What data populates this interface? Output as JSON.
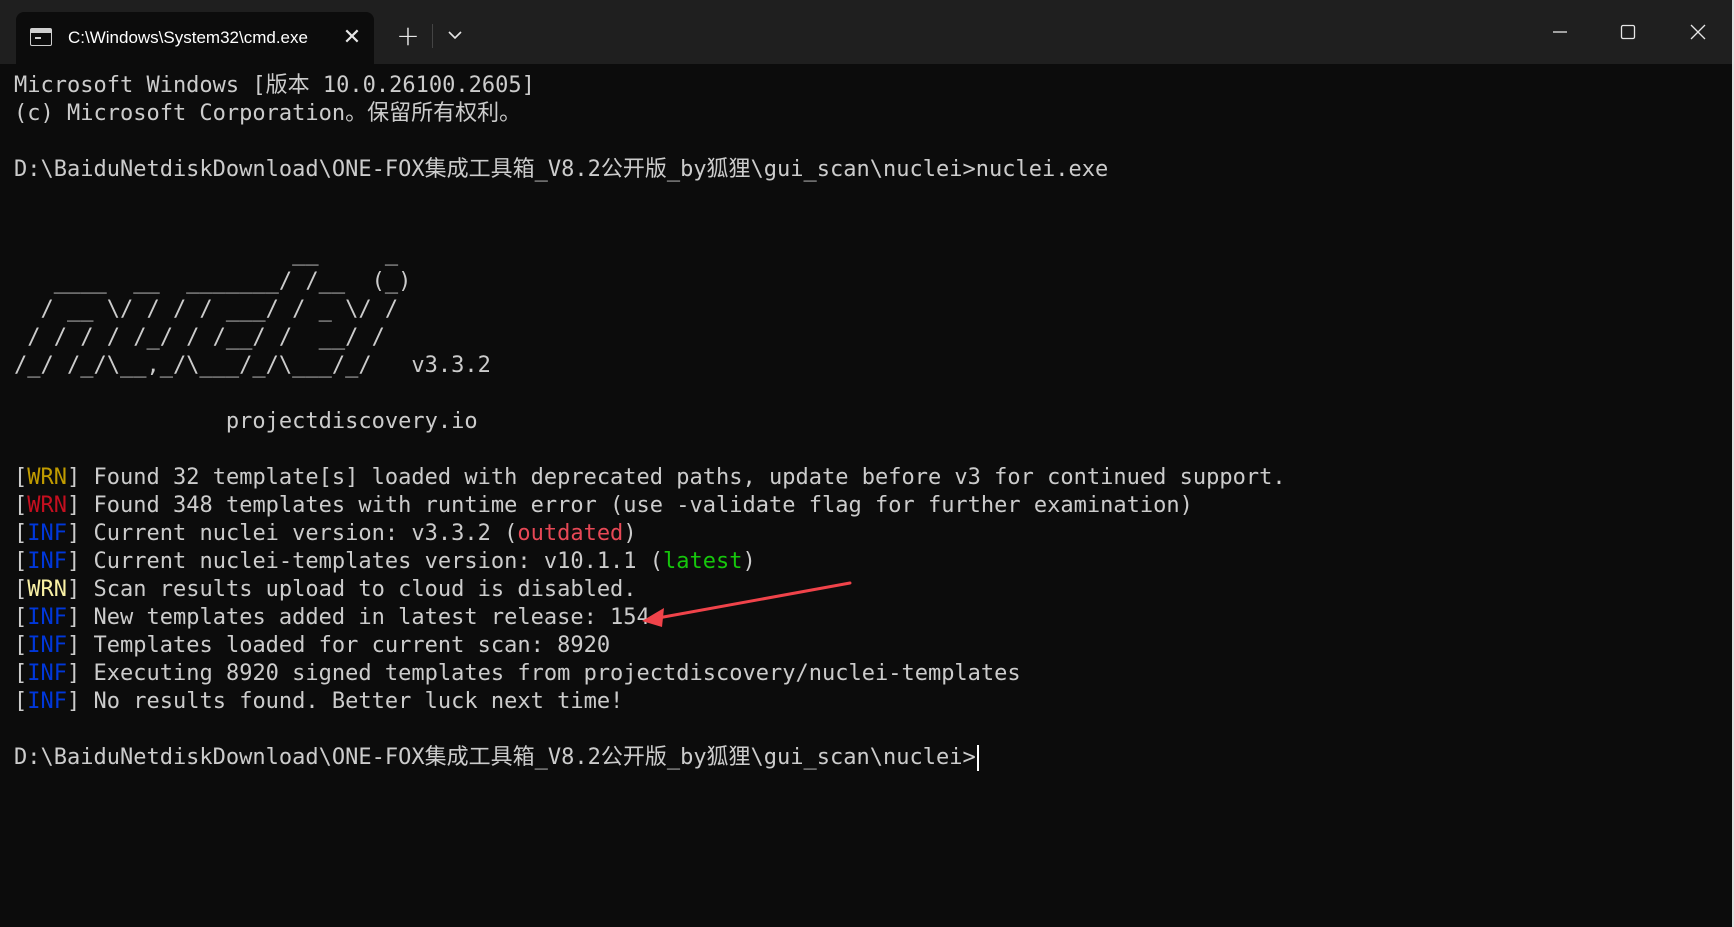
{
  "window": {
    "tab_title": "C:\\Windows\\System32\\cmd.exe",
    "new_tab_glyph": "+",
    "tab_close_glyph": "✕",
    "icons": {
      "tab": "cmd-icon",
      "close_tab": "close-icon",
      "new_tab": "plus-icon",
      "dropdown": "chevron-down-icon",
      "minimize": "minimize-icon",
      "maximize": "maximize-icon",
      "close_window": "close-icon"
    }
  },
  "terminal": {
    "header1": "Microsoft Windows [版本 10.0.26100.2605]",
    "header2": "(c) Microsoft Corporation。保留所有权利。",
    "prompt": "D:\\BaiduNetdiskDownload\\ONE-FOX集成工具箱_V8.2公开版_by狐狸\\gui_scan\\nuclei>",
    "command": "nuclei.exe",
    "banner": [
      "                     __     _",
      "   ____  __  _______/ /__  (_)",
      "  / __ \\/ / / / ___/ / _ \\/ /",
      " / / / / /_/ / /__/ /  __/ /",
      "/_/ /_/\\__,_/\\___/_/\\___/_/   v3.3.2"
    ],
    "site": "                projectdiscovery.io",
    "log": [
      {
        "level": "WRN",
        "color": "#c19c00",
        "pre": "Found 32 template[s] loaded with deprecated paths, update before v3 for continued support.",
        "hl": "",
        "hl_color": "",
        "post": ""
      },
      {
        "level": "WRN",
        "color": "#c50f1f",
        "pre": "Found 348 templates with runtime error (use -validate flag for further examination)",
        "hl": "",
        "hl_color": "",
        "post": ""
      },
      {
        "level": "INF",
        "color": "#0037da",
        "pre": "Current nuclei version: v3.3.2 (",
        "hl": "outdated",
        "hl_color": "#e74856",
        "post": ")"
      },
      {
        "level": "INF",
        "color": "#0037da",
        "pre": "Current nuclei-templates version: v10.1.1 (",
        "hl": "latest",
        "hl_color": "#16c60c",
        "post": ")"
      },
      {
        "level": "WRN",
        "color": "#f9f1a5",
        "pre": "Scan results upload to cloud is disabled.",
        "hl": "",
        "hl_color": "",
        "post": ""
      },
      {
        "level": "INF",
        "color": "#0037da",
        "pre": "New templates added in latest release: 154",
        "hl": "",
        "hl_color": "",
        "post": ""
      },
      {
        "level": "INF",
        "color": "#0037da",
        "pre": "Templates loaded for current scan: 8920",
        "hl": "",
        "hl_color": "",
        "post": ""
      },
      {
        "level": "INF",
        "color": "#0037da",
        "pre": "Executing 8920 signed templates from projectdiscovery/nuclei-templates",
        "hl": "",
        "hl_color": "",
        "post": ""
      },
      {
        "level": "INF",
        "color": "#0037da",
        "pre": "No results found. Better luck next time!",
        "hl": "",
        "hl_color": "",
        "post": ""
      }
    ],
    "annotation_color": "#f0434a"
  }
}
